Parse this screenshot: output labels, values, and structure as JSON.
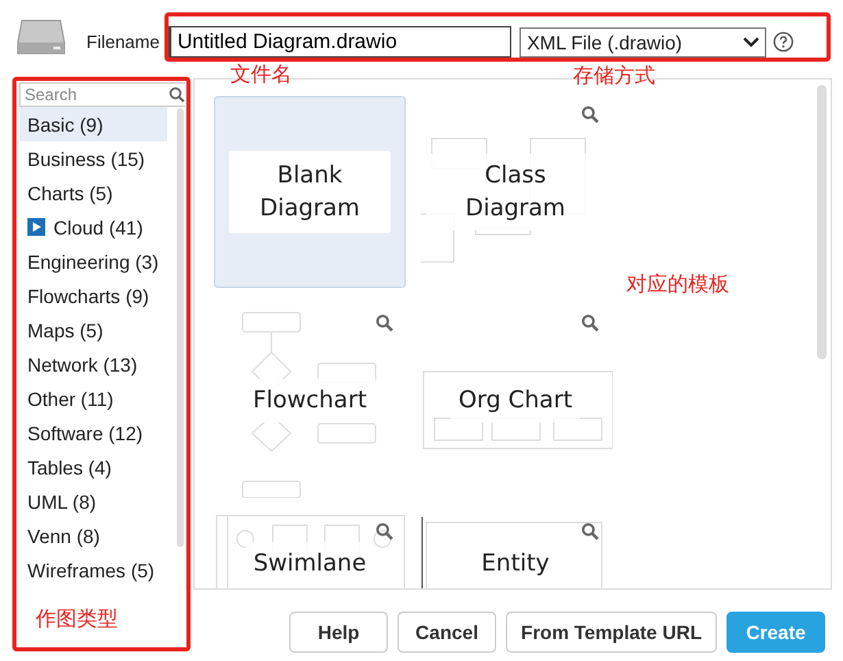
{
  "file": {
    "label": "Filename",
    "value": "Untitled Diagram.drawio",
    "format": "XML File (.drawio)"
  },
  "sidebar": {
    "placeholder": "Search",
    "items": [
      {
        "label": "Basic (9)",
        "selected": true,
        "icon": false
      },
      {
        "label": "Business (15)",
        "selected": false,
        "icon": false
      },
      {
        "label": "Charts (5)",
        "selected": false,
        "icon": false
      },
      {
        "label": "Cloud (41)",
        "selected": false,
        "icon": true
      },
      {
        "label": "Engineering (3)",
        "selected": false,
        "icon": false
      },
      {
        "label": "Flowcharts (9)",
        "selected": false,
        "icon": false
      },
      {
        "label": "Maps (5)",
        "selected": false,
        "icon": false
      },
      {
        "label": "Network (13)",
        "selected": false,
        "icon": false
      },
      {
        "label": "Other (11)",
        "selected": false,
        "icon": false
      },
      {
        "label": "Software (12)",
        "selected": false,
        "icon": false
      },
      {
        "label": "Tables (4)",
        "selected": false,
        "icon": false
      },
      {
        "label": "UML (8)",
        "selected": false,
        "icon": false
      },
      {
        "label": "Venn (8)",
        "selected": false,
        "icon": false
      },
      {
        "label": "Wireframes (5)",
        "selected": false,
        "icon": false
      }
    ]
  },
  "templates": [
    {
      "label": "Blank Diagram",
      "kind": "blank",
      "selected": true
    },
    {
      "label": "Class Diagram",
      "kind": "class",
      "selected": false
    },
    {
      "label": "Flowchart",
      "kind": "flowchart",
      "selected": false
    },
    {
      "label": "Org Chart",
      "kind": "org",
      "selected": false
    },
    {
      "label": "Swimlane",
      "kind": "swimlane",
      "selected": false
    },
    {
      "label": "Entity",
      "kind": "entity",
      "selected": false
    }
  ],
  "buttons": [
    {
      "label": "Help",
      "kind": "default"
    },
    {
      "label": "Cancel",
      "kind": "default"
    },
    {
      "label": "From Template URL",
      "kind": "default"
    },
    {
      "label": "Create",
      "kind": "primary"
    }
  ],
  "annotations": [
    {
      "text": "文件名"
    },
    {
      "text": "存储方式"
    },
    {
      "text": "对应的模板"
    },
    {
      "text": "作图类型"
    }
  ]
}
